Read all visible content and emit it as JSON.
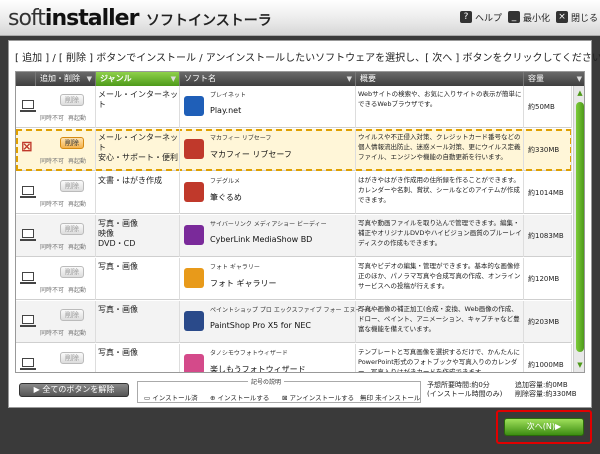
{
  "window": {
    "logo_light": "soft",
    "logo_bold": "installer",
    "title": "ソフトインストーラ",
    "help_label": "ヘルプ",
    "minimize_label": "最小化",
    "close_label": "閉じる"
  },
  "instruction": "[ 追加 ] / [ 削除 ] ボタンでインストール / アンインストールしたいソフトウェアを選択し、[ 次へ ] ボタンをクリックしてください。",
  "columns": {
    "add_remove": "追加・削除",
    "genre": "ジャンル",
    "software": "ソフト名",
    "summary": "概要",
    "size": "容量"
  },
  "rows": [
    {
      "button": "削除",
      "active": false,
      "genre": "メール・インターネット",
      "sub": "プレイネット",
      "name": "Play.net",
      "desc": "Webサイトの検索や、お気に入りサイトの表示が簡単にできるWebブラウザです。",
      "size": "約50MB",
      "icon_color": "#1f5fb8"
    },
    {
      "button": "削除",
      "active": true,
      "genre": "メール・インターネット\n安心・サポート・便利",
      "sub": "マカフィー リブセーフ",
      "name": "マカフィー リブセーフ",
      "desc": "ウイルスや不正侵入対策、クレジットカード番号などの個人情報流出防止、迷惑メール対策、更にウイルス定義ファイル、エンジンや機能の自動更新を行います。",
      "size": "約330MB",
      "icon_color": "#c0392b"
    },
    {
      "button": "削除",
      "active": false,
      "genre": "文書・はがき作成",
      "sub": "フデグルメ",
      "name": "筆ぐるめ",
      "desc": "はがきやはがき作成用の住所録を作ることができます。カレンダーや名刺、賞状、シールなどのアイテムが作成できます。",
      "size": "約1014MB",
      "icon_color": "#c0392b"
    },
    {
      "button": "削除",
      "active": false,
      "genre": "写真・画像\n映像\nDVD・CD",
      "sub": "サイバーリンク メディアショー ビーディー",
      "name": "CyberLink MediaShow BD",
      "desc": "写真や動画ファイルを取り込んで管理できます。編集・補正やオリジナルDVDやハイビジョン画質のブルーレイディスクの作成もできます。",
      "size": "約1083MB",
      "icon_color": "#7a2a9a"
    },
    {
      "button": "削除",
      "active": false,
      "genre": "写真・画像",
      "sub": "フォト ギャラリー",
      "name": "フォト ギャラリー",
      "desc": "写真やビデオの編集・管理ができます。基本的な画像修正のほか、パノラマ写真や合成写真の作成、オンラインサービスへの投稿が行えます。",
      "size": "約120MB",
      "icon_color": "#e89a1a"
    },
    {
      "button": "削除",
      "active": false,
      "genre": "写真・画像",
      "sub": "ペイントショップ プロ エックスファイブ フォー エヌイーシー",
      "name": "PaintShop Pro X5 for NEC",
      "desc": "写真や画像の補正加工(合成・変換、Web画像の作成、ドロー、ペイント、アニメーション、キャプチャなど豊富な機能を備えています。",
      "size": "約203MB",
      "icon_color": "#2a4a8a"
    },
    {
      "button": "削除",
      "active": false,
      "genre": "写真・画像",
      "sub": "タノシモウフォトウィザード",
      "name": "楽しもうフォトウィザード",
      "desc": "テンプレートと写真画像を選択するだけで、かんたんにPowerPoint形式のフォトブックや写真入りのカレンダー、写真入りはがきカードを作成できます。",
      "size": "約1000MB",
      "icon_color": "#d44a8a"
    }
  ],
  "tiny": {
    "not_used": "同時不可",
    "restart": "再起動"
  },
  "footer": {
    "unselect_all": "全てのボタンを解除",
    "legend_title": "記号の説明",
    "legend_installed": "インストール済",
    "legend_install": "インストールする",
    "legend_uninstall": "アンインストールする",
    "legend_none": "無印 未インストール",
    "est_label": "予想所要時間:約0分",
    "est_sub": "(インストール時間のみ)",
    "add_volume": "追加容量:約0MB",
    "del_volume": "削除容量:約330MB"
  },
  "next_label": "次へ(N)▶"
}
